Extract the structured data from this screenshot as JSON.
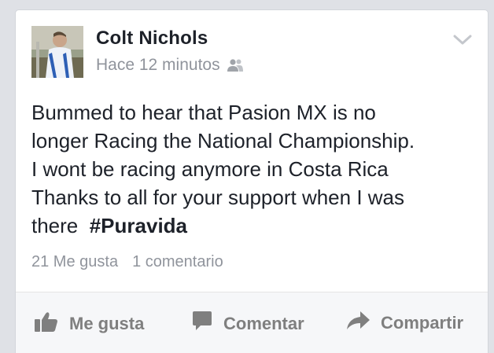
{
  "post": {
    "author_name": "Colt Nichols",
    "timestamp": "Hace 12 minutos",
    "audience_icon": "friends-icon",
    "menu_icon": "chevron-down-icon",
    "body_lines": [
      "Bummed to hear that Pasion MX is no",
      "longer Racing the National Championship.",
      "I wont be racing anymore in Costa Rica",
      "Thanks to all for your support when I was"
    ],
    "body_last_prefix": "there  ",
    "hashtag": "#Puravida"
  },
  "stats": {
    "likes": "21 Me gusta",
    "comments": "1 comentario"
  },
  "actions": {
    "like_label": "Me gusta",
    "like_icon": "thumbs-up-icon",
    "comment_label": "Comentar",
    "comment_icon": "comment-bubble-icon",
    "share_label": "Compartir",
    "share_icon": "share-arrow-icon"
  },
  "colors": {
    "page_bg": "#dfe1e6",
    "card_bg": "#ffffff",
    "author_text": "#1d2129",
    "secondary_text": "#90949c",
    "action_text": "#7f7f7f",
    "action_bar_bg": "#f6f7f9"
  }
}
